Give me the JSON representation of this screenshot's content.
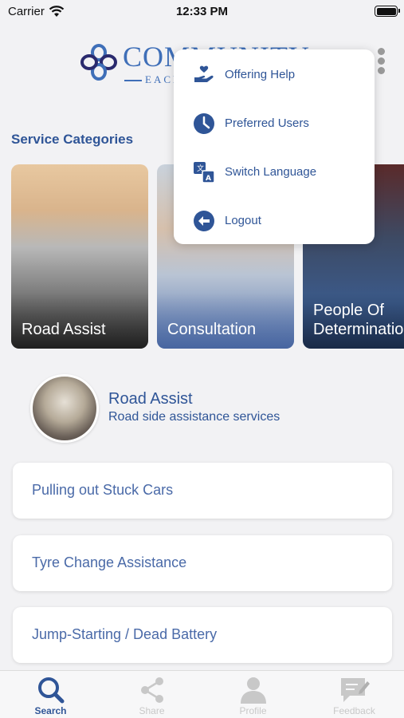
{
  "status_bar": {
    "carrier": "Carrier",
    "time": "12:33 PM"
  },
  "logo": {
    "text": "COMMUNITY",
    "tagline": "EACH"
  },
  "section": {
    "title": "Service Categories"
  },
  "categories": [
    {
      "label": "Road Assist"
    },
    {
      "label": "Consultation"
    },
    {
      "label": "People Of Determination"
    }
  ],
  "selected": {
    "title": "Road Assist",
    "subtitle": "Road side assistance services"
  },
  "services": [
    {
      "label": "Pulling out Stuck Cars"
    },
    {
      "label": "Tyre Change Assistance"
    },
    {
      "label": "Jump-Starting / Dead Battery"
    }
  ],
  "menu": [
    {
      "label": "Offering Help",
      "icon": "hand-heart-icon"
    },
    {
      "label": "Preferred Users",
      "icon": "clock-icon"
    },
    {
      "label": "Switch Language",
      "icon": "translate-icon"
    },
    {
      "label": "Logout",
      "icon": "logout-arrow-icon"
    }
  ],
  "tabs": [
    {
      "label": "Search",
      "icon": "search-icon",
      "active": true
    },
    {
      "label": "Share",
      "icon": "share-icon",
      "active": false
    },
    {
      "label": "Profile",
      "icon": "profile-icon",
      "active": false
    },
    {
      "label": "Feedback",
      "icon": "feedback-icon",
      "active": false
    }
  ],
  "colors": {
    "brand_blue": "#2f5597",
    "background": "#f2f2f4",
    "inactive": "#c8c8c8"
  }
}
